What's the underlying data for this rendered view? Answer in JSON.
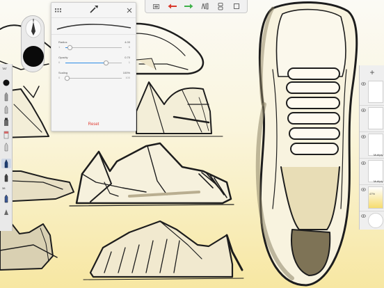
{
  "brush_panel": {
    "radius": {
      "label": "Radius",
      "value": "4.00",
      "min": "1",
      "max": "5",
      "level": 0.08
    },
    "opacity": {
      "label": "Opacity",
      "value": "0.70",
      "min": "0",
      "max": "1",
      "level": 0.72
    },
    "scaling": {
      "label": "Scaling",
      "value": "100%",
      "min": "0",
      "max": "100",
      "level": 0.02
    },
    "reset_label": "Reset"
  },
  "left_toolbar": {
    "text_tool_label": "TAT",
    "size_label": "38"
  },
  "layers": {
    "add_label": "+",
    "rows": [
      {
        "blend": "",
        "opacity": ""
      },
      {
        "blend": "",
        "opacity": ""
      },
      {
        "blend": "Multiply",
        "opacity": ""
      },
      {
        "blend": "Multiply",
        "opacity": ""
      },
      {
        "blend": "",
        "opacity": "47%"
      },
      {
        "blend": "",
        "opacity": ""
      }
    ]
  },
  "colors": {
    "accent_blue": "#2a8be6",
    "reset_red": "#e0392f",
    "undo_red": "#d9372b",
    "redo_green": "#3fb14b"
  },
  "icons": [
    "grid-icon",
    "brush-icon",
    "close-icon",
    "undo-icon",
    "redo-icon",
    "ruler-icon",
    "layers-icon",
    "eye-icon",
    "pen-icon"
  ]
}
